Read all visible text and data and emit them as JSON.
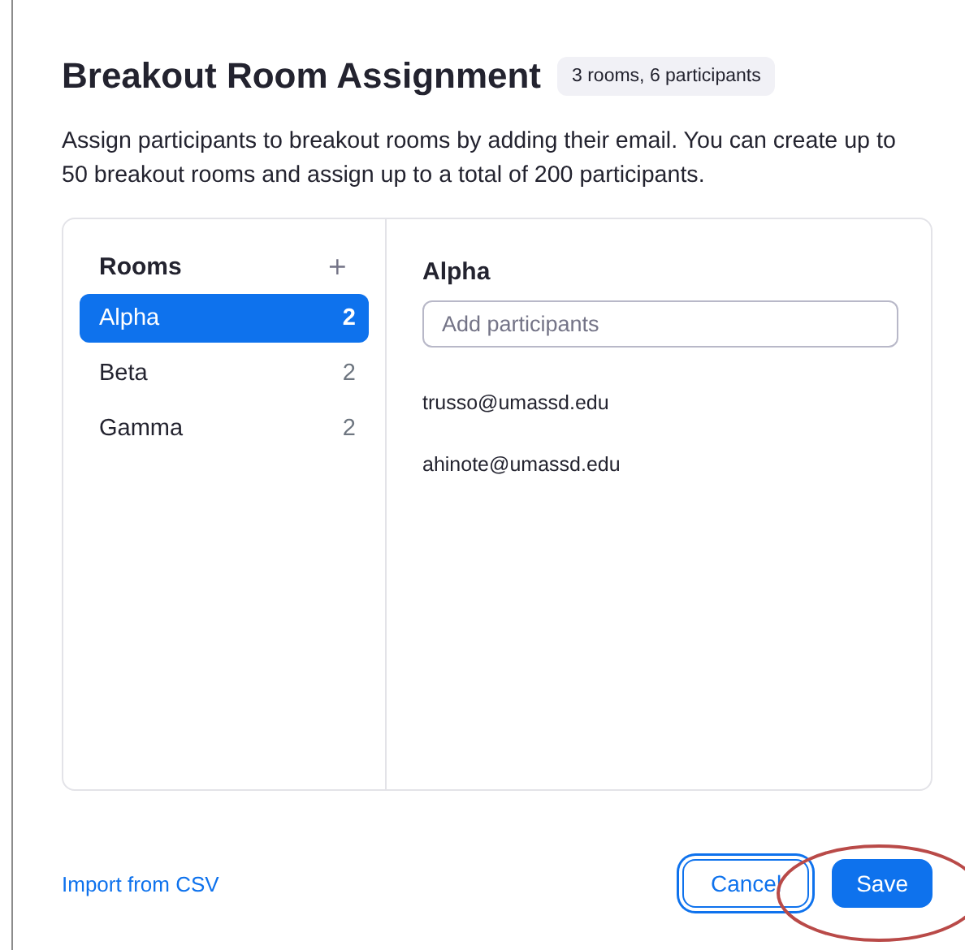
{
  "dialog": {
    "title": "Breakout Room Assignment",
    "badge": "3 rooms, 6 participants",
    "description": "Assign participants to breakout rooms by adding their email. You can create up to 50 breakout rooms and assign up to a total of 200 participants."
  },
  "rooms_panel": {
    "header": "Rooms",
    "add": "+",
    "rooms": [
      {
        "name": "Alpha",
        "count": "2",
        "selected": true
      },
      {
        "name": "Beta",
        "count": "2",
        "selected": false
      },
      {
        "name": "Gamma",
        "count": "2",
        "selected": false
      }
    ]
  },
  "detail": {
    "title": "Alpha",
    "search": {
      "placeholder": "Add participants"
    },
    "participants": [
      "trusso@umassd.edu",
      "ahinote@umassd.edu"
    ]
  },
  "footer": {
    "link": "Import from CSV",
    "buttons": [
      {
        "label": "Cancel",
        "kind": "secondary",
        "focused": true
      },
      {
        "label": "Save",
        "kind": "primary",
        "focused": false
      }
    ]
  }
}
